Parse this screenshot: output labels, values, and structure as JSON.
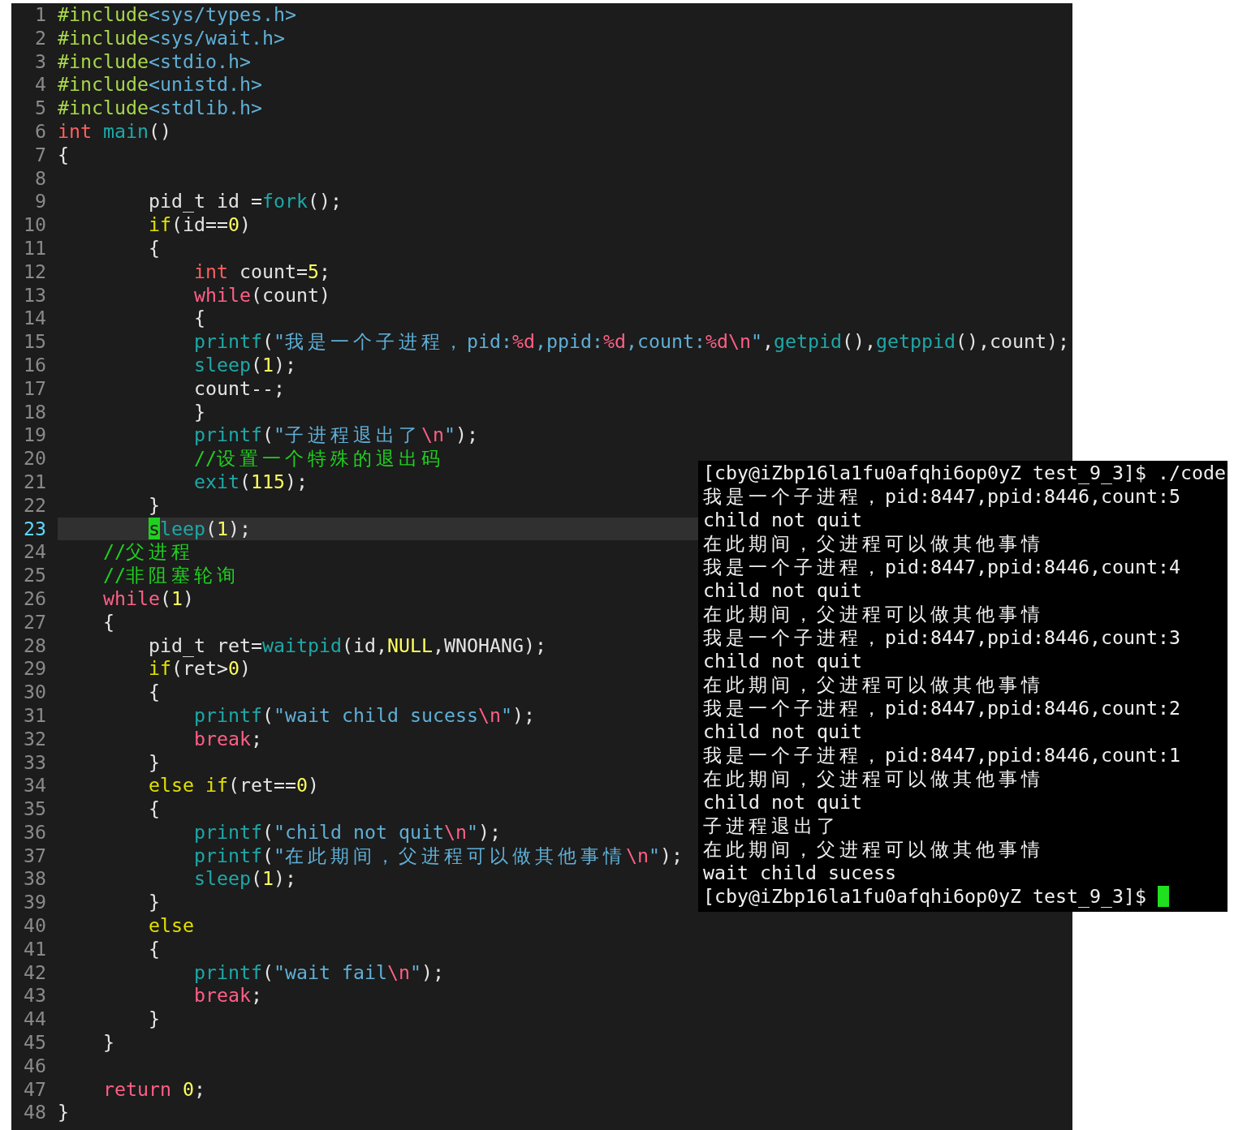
{
  "editor": {
    "lines": [
      {
        "number": "1",
        "current": false,
        "tokens": [
          {
            "kind": "preproc",
            "text": "#include"
          },
          {
            "kind": "header",
            "text": "<sys/types.h>"
          }
        ]
      },
      {
        "number": "2",
        "current": false,
        "tokens": [
          {
            "kind": "preproc",
            "text": "#include"
          },
          {
            "kind": "header",
            "text": "<sys/wait.h>"
          }
        ]
      },
      {
        "number": "3",
        "current": false,
        "tokens": [
          {
            "kind": "preproc",
            "text": "#include"
          },
          {
            "kind": "header",
            "text": "<stdio.h>"
          }
        ]
      },
      {
        "number": "4",
        "current": false,
        "tokens": [
          {
            "kind": "preproc",
            "text": "#include"
          },
          {
            "kind": "header",
            "text": "<unistd.h>"
          }
        ]
      },
      {
        "number": "5",
        "current": false,
        "tokens": [
          {
            "kind": "preproc",
            "text": "#include"
          },
          {
            "kind": "header",
            "text": "<stdlib.h>"
          }
        ]
      },
      {
        "number": "6",
        "current": false,
        "tokens": [
          {
            "kind": "type",
            "text": "int"
          },
          {
            "kind": "func",
            "text": " main"
          },
          {
            "kind": "plain",
            "text": "()"
          }
        ]
      },
      {
        "number": "7",
        "current": false,
        "tokens": [
          {
            "kind": "plain",
            "text": "{"
          }
        ]
      },
      {
        "number": "8",
        "current": false
      },
      {
        "number": "9",
        "current": false,
        "tokens": [
          {
            "kind": "plain",
            "text": "        pid_t id ="
          },
          {
            "kind": "func",
            "text": "fork"
          },
          {
            "kind": "plain",
            "text": "();"
          }
        ]
      },
      {
        "number": "10",
        "current": false,
        "tokens": [
          {
            "kind": "keyword",
            "text": "        if"
          },
          {
            "kind": "plain",
            "text": "(id=="
          },
          {
            "kind": "number",
            "text": "0"
          },
          {
            "kind": "plain",
            "text": ")"
          }
        ]
      },
      {
        "number": "11",
        "current": false,
        "tokens": [
          {
            "kind": "plain",
            "text": "        {"
          }
        ]
      },
      {
        "number": "12",
        "current": false,
        "tokens": [
          {
            "kind": "type",
            "text": "            int"
          },
          {
            "kind": "plain",
            "text": " count="
          },
          {
            "kind": "number",
            "text": "5"
          },
          {
            "kind": "plain",
            "text": ";"
          }
        ]
      },
      {
        "number": "13",
        "current": false,
        "tokens": [
          {
            "kind": "statement",
            "text": "            while"
          },
          {
            "kind": "plain",
            "text": "(count)"
          }
        ]
      },
      {
        "number": "14",
        "current": false,
        "tokens": [
          {
            "kind": "plain",
            "text": "            {"
          }
        ]
      },
      {
        "number": "15",
        "current": false,
        "tokens": [
          {
            "kind": "func",
            "text": "            printf"
          },
          {
            "kind": "plain",
            "text": "("
          },
          {
            "kind": "string",
            "text": "\"我是一个子进程，pid:"
          },
          {
            "kind": "escape",
            "text": "%d"
          },
          {
            "kind": "string",
            "text": ",ppid:"
          },
          {
            "kind": "escape",
            "text": "%d"
          },
          {
            "kind": "string",
            "text": ",count:"
          },
          {
            "kind": "escape",
            "text": "%d\\n"
          },
          {
            "kind": "string",
            "text": "\""
          },
          {
            "kind": "plain",
            "text": ","
          },
          {
            "kind": "func",
            "text": "getpid"
          },
          {
            "kind": "plain",
            "text": "(),"
          },
          {
            "kind": "func",
            "text": "getppid"
          },
          {
            "kind": "plain",
            "text": "(),count);"
          }
        ]
      },
      {
        "number": "16",
        "current": false,
        "tokens": [
          {
            "kind": "func",
            "text": "            sleep"
          },
          {
            "kind": "plain",
            "text": "("
          },
          {
            "kind": "number",
            "text": "1"
          },
          {
            "kind": "plain",
            "text": ");"
          }
        ]
      },
      {
        "number": "17",
        "current": false,
        "tokens": [
          {
            "kind": "plain",
            "text": "            count--;"
          }
        ]
      },
      {
        "number": "18",
        "current": false,
        "tokens": [
          {
            "kind": "plain",
            "text": "            }"
          }
        ]
      },
      {
        "number": "19",
        "current": false,
        "tokens": [
          {
            "kind": "func",
            "text": "            printf"
          },
          {
            "kind": "plain",
            "text": "("
          },
          {
            "kind": "string",
            "text": "\"子进程退出了"
          },
          {
            "kind": "escape",
            "text": "\\n"
          },
          {
            "kind": "string",
            "text": "\""
          },
          {
            "kind": "plain",
            "text": ");"
          }
        ]
      },
      {
        "number": "20",
        "current": false,
        "tokens": [
          {
            "kind": "comment",
            "text": "            //设置一个特殊的退出码"
          }
        ]
      },
      {
        "number": "21",
        "current": false,
        "tokens": [
          {
            "kind": "func",
            "text": "            exit"
          },
          {
            "kind": "plain",
            "text": "("
          },
          {
            "kind": "number",
            "text": "115"
          },
          {
            "kind": "plain",
            "text": ");"
          }
        ]
      },
      {
        "number": "22",
        "current": false,
        "tokens": [
          {
            "kind": "plain",
            "text": "        }"
          }
        ]
      },
      {
        "number": "23",
        "current": true,
        "tokens": [
          {
            "kind": "func_at_cursor",
            "text": "        sleep"
          },
          {
            "kind": "plain",
            "text": "("
          },
          {
            "kind": "number",
            "text": "1"
          },
          {
            "kind": "plain",
            "text": ");"
          }
        ]
      },
      {
        "number": "24",
        "current": false,
        "tokens": [
          {
            "kind": "comment",
            "text": "    //父进程"
          }
        ]
      },
      {
        "number": "25",
        "current": false,
        "tokens": [
          {
            "kind": "comment",
            "text": "    //非阻塞轮询"
          }
        ]
      },
      {
        "number": "26",
        "current": false,
        "tokens": [
          {
            "kind": "statement",
            "text": "    while"
          },
          {
            "kind": "plain",
            "text": "("
          },
          {
            "kind": "number",
            "text": "1"
          },
          {
            "kind": "plain",
            "text": ")"
          }
        ]
      },
      {
        "number": "27",
        "current": false,
        "tokens": [
          {
            "kind": "plain",
            "text": "    {"
          }
        ]
      },
      {
        "number": "28",
        "current": false,
        "tokens": [
          {
            "kind": "plain",
            "text": "        pid_t ret="
          },
          {
            "kind": "func",
            "text": "waitpid"
          },
          {
            "kind": "plain",
            "text": "(id,"
          },
          {
            "kind": "constant",
            "text": "NULL"
          },
          {
            "kind": "plain",
            "text": ",WNOHANG);"
          }
        ]
      },
      {
        "number": "29",
        "current": false,
        "tokens": [
          {
            "kind": "keyword",
            "text": "        if"
          },
          {
            "kind": "plain",
            "text": "(ret>"
          },
          {
            "kind": "number",
            "text": "0"
          },
          {
            "kind": "plain",
            "text": ")"
          }
        ]
      },
      {
        "number": "30",
        "current": false,
        "tokens": [
          {
            "kind": "plain",
            "text": "        {"
          }
        ]
      },
      {
        "number": "31",
        "current": false,
        "tokens": [
          {
            "kind": "func",
            "text": "            printf"
          },
          {
            "kind": "plain",
            "text": "("
          },
          {
            "kind": "string",
            "text": "\"wait child sucess"
          },
          {
            "kind": "escape",
            "text": "\\n"
          },
          {
            "kind": "string",
            "text": "\""
          },
          {
            "kind": "plain",
            "text": ");"
          }
        ]
      },
      {
        "number": "32",
        "current": false,
        "tokens": [
          {
            "kind": "statement",
            "text": "            break"
          },
          {
            "kind": "plain",
            "text": ";"
          }
        ]
      },
      {
        "number": "33",
        "current": false,
        "tokens": [
          {
            "kind": "plain",
            "text": "        }"
          }
        ]
      },
      {
        "number": "34",
        "current": false,
        "tokens": [
          {
            "kind": "keyword",
            "text": "        else if"
          },
          {
            "kind": "plain",
            "text": "(ret=="
          },
          {
            "kind": "number",
            "text": "0"
          },
          {
            "kind": "plain",
            "text": ")"
          }
        ]
      },
      {
        "number": "35",
        "current": false,
        "tokens": [
          {
            "kind": "plain",
            "text": "        {"
          }
        ]
      },
      {
        "number": "36",
        "current": false,
        "tokens": [
          {
            "kind": "func",
            "text": "            printf"
          },
          {
            "kind": "plain",
            "text": "("
          },
          {
            "kind": "string",
            "text": "\"child not quit"
          },
          {
            "kind": "escape",
            "text": "\\n"
          },
          {
            "kind": "string",
            "text": "\""
          },
          {
            "kind": "plain",
            "text": ");"
          }
        ]
      },
      {
        "number": "37",
        "current": false,
        "tokens": [
          {
            "kind": "func",
            "text": "            printf"
          },
          {
            "kind": "plain",
            "text": "("
          },
          {
            "kind": "string",
            "text": "\"在此期间，父进程可以做其他事情"
          },
          {
            "kind": "escape",
            "text": "\\n"
          },
          {
            "kind": "string",
            "text": "\""
          },
          {
            "kind": "plain",
            "text": ");"
          }
        ]
      },
      {
        "number": "38",
        "current": false,
        "tokens": [
          {
            "kind": "func",
            "text": "            sleep"
          },
          {
            "kind": "plain",
            "text": "("
          },
          {
            "kind": "number",
            "text": "1"
          },
          {
            "kind": "plain",
            "text": ");"
          }
        ]
      },
      {
        "number": "39",
        "current": false,
        "tokens": [
          {
            "kind": "plain",
            "text": "        }"
          }
        ]
      },
      {
        "number": "40",
        "current": false,
        "tokens": [
          {
            "kind": "keyword",
            "text": "        else"
          }
        ]
      },
      {
        "number": "41",
        "current": false,
        "tokens": [
          {
            "kind": "plain",
            "text": "        {"
          }
        ]
      },
      {
        "number": "42",
        "current": false,
        "tokens": [
          {
            "kind": "func",
            "text": "            printf"
          },
          {
            "kind": "plain",
            "text": "("
          },
          {
            "kind": "string",
            "text": "\"wait fail"
          },
          {
            "kind": "escape",
            "text": "\\n"
          },
          {
            "kind": "string",
            "text": "\""
          },
          {
            "kind": "plain",
            "text": ");"
          }
        ]
      },
      {
        "number": "43",
        "current": false,
        "tokens": [
          {
            "kind": "statement",
            "text": "            break"
          },
          {
            "kind": "plain",
            "text": ";"
          }
        ]
      },
      {
        "number": "44",
        "current": false,
        "tokens": [
          {
            "kind": "plain",
            "text": "        }"
          }
        ]
      },
      {
        "number": "45",
        "current": false,
        "tokens": [
          {
            "kind": "plain",
            "text": "    }"
          }
        ]
      },
      {
        "number": "46",
        "current": false
      },
      {
        "number": "47",
        "current": false,
        "tokens": [
          {
            "kind": "statement",
            "text": "    return"
          },
          {
            "kind": "number",
            "text": " 0"
          },
          {
            "kind": "plain",
            "text": ";"
          }
        ]
      },
      {
        "number": "48",
        "current": false,
        "tokens": [
          {
            "kind": "plain",
            "text": "}"
          }
        ]
      }
    ]
  },
  "terminal": {
    "cursor": true,
    "lines": [
      "[cby@iZbp16la1fu0afqhi6op0yZ test_9_3]$ ./code",
      "我是一个子进程，pid:8447,ppid:8446,count:5",
      "child not quit",
      "在此期间，父进程可以做其他事情",
      "我是一个子进程，pid:8447,ppid:8446,count:4",
      "child not quit",
      "在此期间，父进程可以做其他事情",
      "我是一个子进程，pid:8447,ppid:8446,count:3",
      "child not quit",
      "在此期间，父进程可以做其他事情",
      "我是一个子进程，pid:8447,ppid:8446,count:2",
      "child not quit",
      "我是一个子进程，pid:8447,ppid:8446,count:1",
      "在此期间，父进程可以做其他事情",
      "child not quit",
      "子进程退出了",
      "在此期间，父进程可以做其他事情",
      "wait child sucess",
      "[cby@iZbp16la1fu0afqhi6op0yZ test_9_3]$"
    ]
  }
}
